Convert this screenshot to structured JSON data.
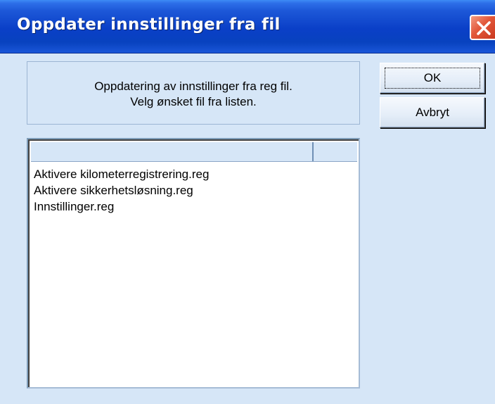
{
  "window": {
    "title": "Oppdater innstillinger fra fil"
  },
  "info": {
    "line1": "Oppdatering av innstillinger fra reg fil.",
    "line2": "Velg ønsket fil fra listen."
  },
  "buttons": {
    "ok_label": "OK",
    "cancel_label": "Avbryt"
  },
  "file_list": {
    "columns": [
      "",
      ""
    ],
    "items": [
      "Aktivere kilometerregistrering.reg",
      "Aktivere sikkerhetsløsning.reg",
      "Innstillinger.reg"
    ]
  },
  "icons": {
    "close": "close-icon"
  },
  "colors": {
    "titlebar": "#0a3fc7",
    "close_button": "#e2573a",
    "dialog_background": "#d6e6f7"
  }
}
